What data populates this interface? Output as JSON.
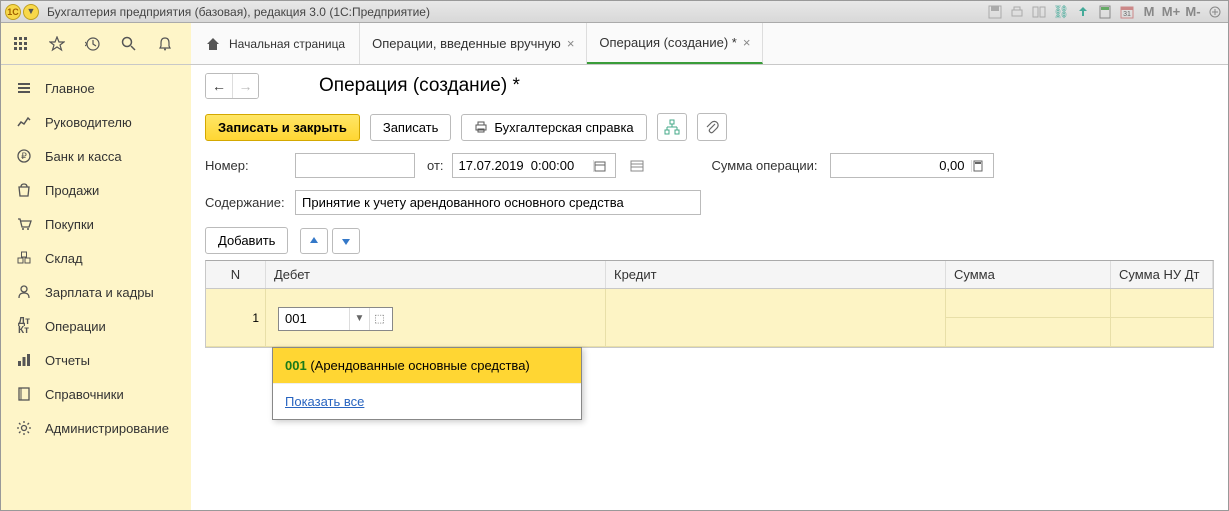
{
  "titlebar": {
    "title": "Бухгалтерия предприятия (базовая), редакция 3.0  (1С:Предприятие)",
    "logo_text": "1C",
    "btn_m": "M",
    "btn_mplus": "M+",
    "btn_mminus": "M-"
  },
  "tabs": {
    "home": "Начальная страница",
    "tab1": "Операции, введенные вручную",
    "tab2": "Операция (создание) *"
  },
  "sidebar": {
    "items": [
      {
        "label": "Главное"
      },
      {
        "label": "Руководителю"
      },
      {
        "label": "Банк и касса"
      },
      {
        "label": "Продажи"
      },
      {
        "label": "Покупки"
      },
      {
        "label": "Склад"
      },
      {
        "label": "Зарплата и кадры"
      },
      {
        "label": "Операции"
      },
      {
        "label": "Отчеты"
      },
      {
        "label": "Справочники"
      },
      {
        "label": "Администрирование"
      }
    ]
  },
  "page": {
    "title": "Операция (создание) *",
    "save_close": "Записать и закрыть",
    "save": "Записать",
    "print_ref": "Бухгалтерская справка",
    "number_label": "Номер:",
    "number_value": "",
    "from_label": "от:",
    "date_value": "17.07.2019  0:00:00",
    "sum_label": "Сумма операции:",
    "sum_value": "0,00",
    "content_label": "Содержание:",
    "content_value": "Принятие к учету арендованного основного средства",
    "add_btn": "Добавить"
  },
  "grid": {
    "headers": {
      "n": "N",
      "debit": "Дебет",
      "credit": "Кредит",
      "sum": "Сумма",
      "sum_nu": "Сумма НУ Дт"
    },
    "row": {
      "n": "1",
      "debit_value": "001"
    }
  },
  "autocomplete": {
    "code": "001",
    "desc": " (Арендованные основные средства)",
    "show_all": "Показать все"
  }
}
